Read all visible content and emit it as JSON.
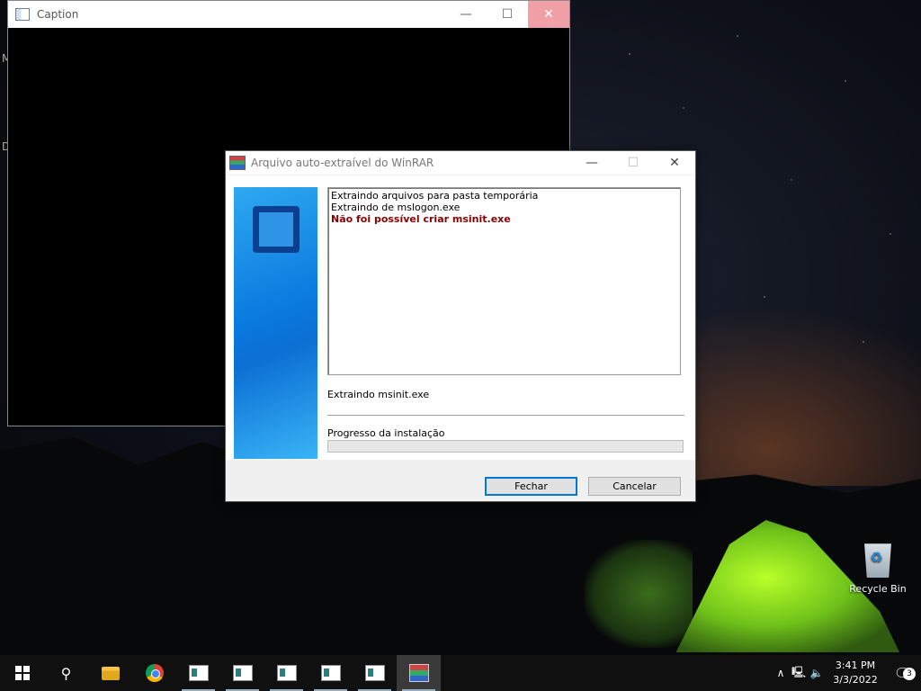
{
  "caption_window": {
    "title": "Caption",
    "left_fragments": [
      "M",
      "D"
    ]
  },
  "dialog": {
    "title": "Arquivo auto-extraível do WinRAR",
    "log_lines": [
      {
        "text": "Extraindo arquivos para pasta temporária",
        "error": false
      },
      {
        "text": "Extraindo de mslogon.exe",
        "error": false
      },
      {
        "text": "Não foi possível criar msinit.exe",
        "error": true
      }
    ],
    "status": "Extraindo msinit.exe",
    "progress_label": "Progresso da instalação",
    "progress_value": 0,
    "buttons": {
      "close_label": "Fechar",
      "cancel_label": "Cancelar"
    },
    "error_color": "#8b0000",
    "accent_color": "#0078d7"
  },
  "desktop": {
    "recycle_bin_label": "Recycle Bin"
  },
  "taskbar": {
    "items": [
      {
        "icon": "windows-start-icon"
      },
      {
        "icon": "search-icon"
      },
      {
        "icon": "file-explorer-icon"
      },
      {
        "icon": "chrome-icon"
      },
      {
        "icon": "app-window-icon"
      },
      {
        "icon": "app-window-icon"
      },
      {
        "icon": "app-window-icon"
      },
      {
        "icon": "app-window-icon"
      },
      {
        "icon": "app-window-icon"
      },
      {
        "icon": "winrar-icon"
      }
    ],
    "clock": {
      "time": "3:41 PM",
      "date": "3/3/2022"
    },
    "notification_count": "3"
  }
}
